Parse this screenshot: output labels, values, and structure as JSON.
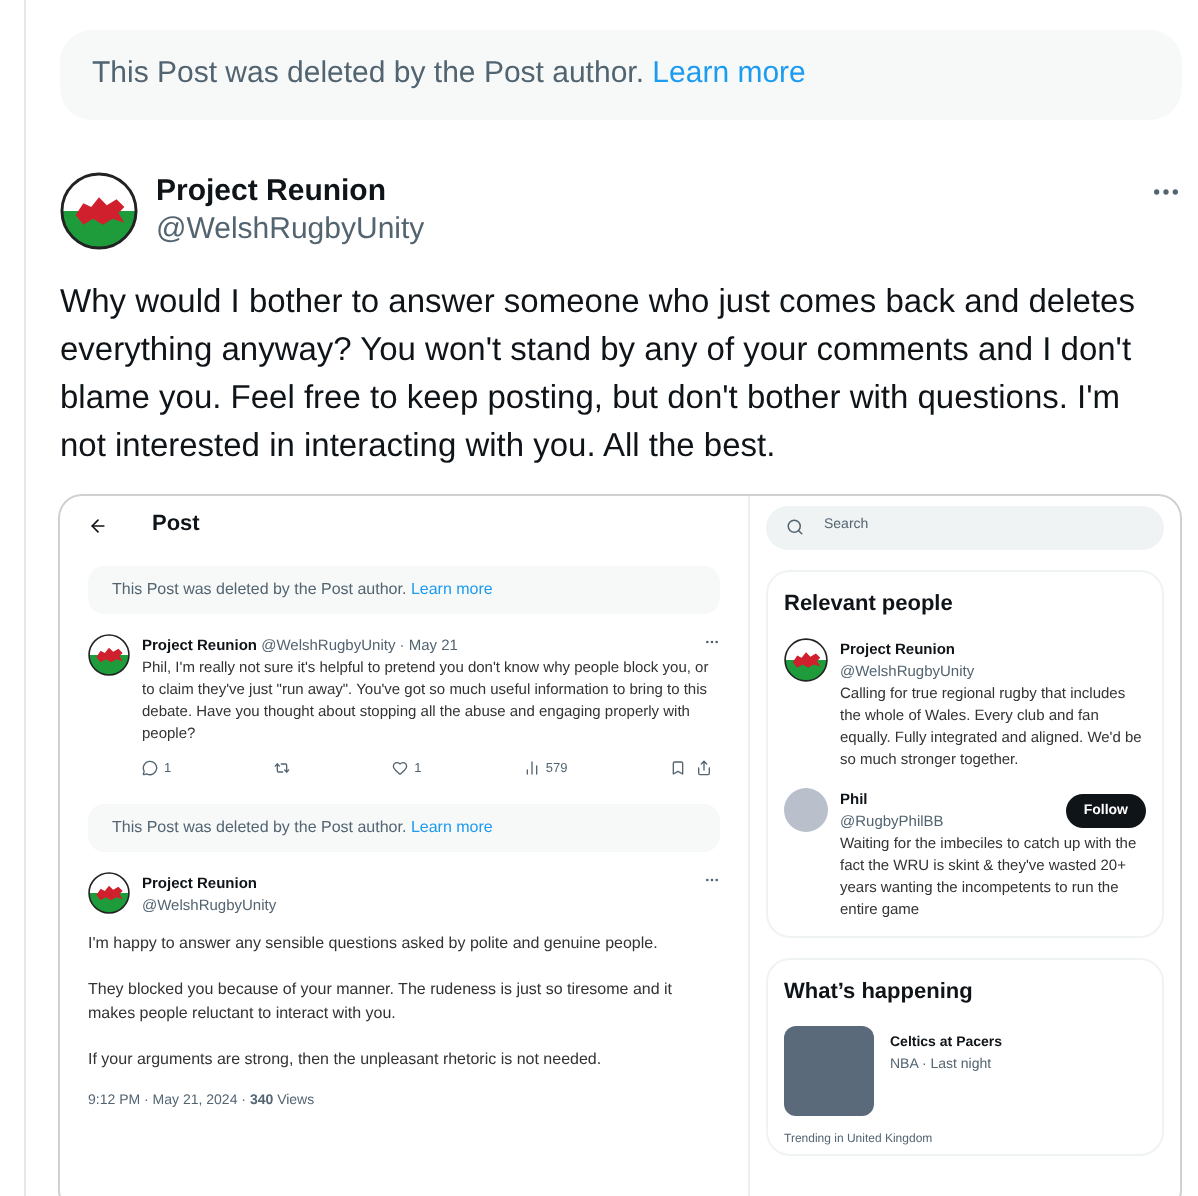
{
  "deleted_notice": {
    "text": "This Post was deleted by the Post author.",
    "link": "Learn more"
  },
  "post": {
    "name": "Project Reunion",
    "handle": "@WelshRugbyUnity",
    "text": "Why would I bother to answer someone who just comes back and deletes everything anyway? You won't stand by any of your comments and I don't blame you. Feel free to keep posting, but don't bother with questions. I'm not interested in interacting with you. All the best."
  },
  "embedded_screenshot": {
    "header": {
      "title": "Post"
    },
    "deleted_notices": [
      {
        "text": "This Post was deleted by the Post author.",
        "link": "Learn more"
      },
      {
        "text": "This Post was deleted by the Post author.",
        "link": "Learn more"
      }
    ],
    "reply": {
      "name": "Project Reunion",
      "meta": "@WelshRugbyUnity · May 21",
      "text": "Phil, I'm really not sure it's helpful to pretend you don't know why people block you, or to claim they've just \"run away\". You've got so much useful information to bring to this debate. Have you thought about stopping all the abuse and engaging properly with people?",
      "actions": [
        {
          "kind": "reply",
          "count": "1"
        },
        {
          "kind": "repost"
        },
        {
          "kind": "like",
          "count": "1"
        },
        {
          "kind": "views",
          "count": "579"
        },
        {
          "kind": "bookmark"
        },
        {
          "kind": "share"
        }
      ]
    },
    "main_post": {
      "name": "Project Reunion",
      "handle": "@WelshRugbyUnity",
      "paragraphs": [
        "I'm happy to answer any sensible questions asked by polite and genuine people.",
        "They blocked you because of your manner. The rudeness is just so tiresome and it makes people reluctant to interact with you.",
        "If your arguments are strong, then the unpleasant rhetoric is not needed."
      ],
      "footer": "9:12 PM · May 21, 2024 · **340** Views"
    },
    "search": {
      "placeholder": "Search"
    },
    "relevant_people": {
      "title": "Relevant people",
      "people": [
        {
          "kind": "flag",
          "name": "Project Reunion",
          "handle": "@WelshRugbyUnity",
          "bio": "Calling for true regional rugby that includes the whole of Wales. Every club and fan equally. Fully integrated and aligned. We'd be so much stronger together."
        },
        {
          "kind": "photo",
          "name": "Phil",
          "handle": "@RugbyPhilBB",
          "follow": "Follow",
          "bio": "Waiting for the imbeciles to catch up with the fact the WRU is skint & they've wasted 20+ years wanting the incompetents to run the entire game"
        }
      ]
    },
    "whats_happening": {
      "title": "What’s happening",
      "items": [
        {
          "title": "Celtics at Pacers",
          "meta": "NBA · Last night"
        }
      ],
      "trending_label": "Trending in United Kingdom"
    }
  }
}
